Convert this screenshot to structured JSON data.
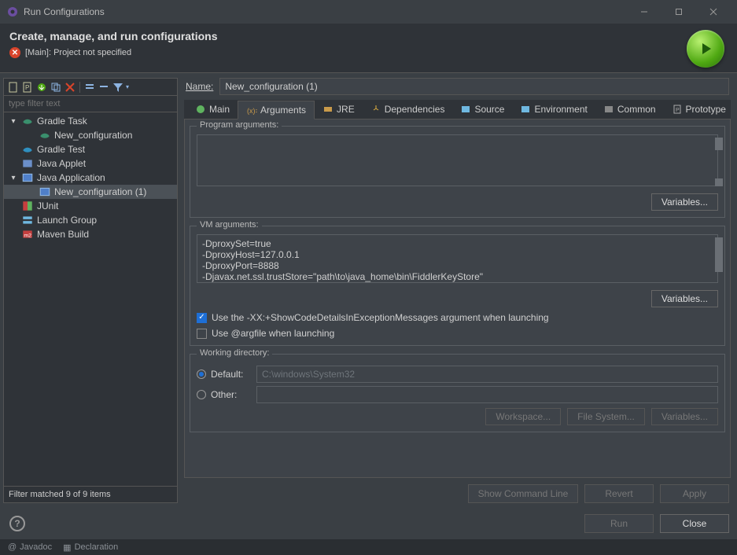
{
  "window": {
    "title": "Run Configurations"
  },
  "header": {
    "title": "Create, manage, and run configurations",
    "error": "[Main]: Project not specified"
  },
  "left": {
    "filter_placeholder": "type filter text",
    "status": "Filter matched 9 of 9 items",
    "tree": [
      {
        "label": "Gradle Task",
        "expand": true,
        "icon": "gradle"
      },
      {
        "label": "New_configuration",
        "indent": 2,
        "icon": "gradle"
      },
      {
        "label": "Gradle Test",
        "icon": "gradle-test",
        "indent": 1
      },
      {
        "label": "Java Applet",
        "icon": "applet",
        "indent": 1
      },
      {
        "label": "Java Application",
        "icon": "java-app",
        "expand": true
      },
      {
        "label": "New_configuration (1)",
        "indent": 2,
        "icon": "java-app",
        "selected": true
      },
      {
        "label": "JUnit",
        "icon": "junit",
        "indent": 1
      },
      {
        "label": "Launch Group",
        "icon": "launch-group",
        "indent": 1
      },
      {
        "label": "Maven Build",
        "icon": "maven",
        "indent": 1
      }
    ]
  },
  "right": {
    "name_label": "Name:",
    "name_value": "New_configuration (1)",
    "tabs": [
      {
        "label": "Main"
      },
      {
        "label": "Arguments",
        "active": true
      },
      {
        "label": "JRE"
      },
      {
        "label": "Dependencies"
      },
      {
        "label": "Source"
      },
      {
        "label": "Environment"
      },
      {
        "label": "Common"
      },
      {
        "label": "Prototype"
      }
    ],
    "program_args": {
      "title": "Program arguments:",
      "value": "",
      "variables_btn": "Variables..."
    },
    "vm_args": {
      "title": "VM arguments:",
      "value": "-DproxySet=true\n-DproxyHost=127.0.0.1\n-DproxyPort=8888\n-Djavax.net.ssl.trustStore=\"path\\to\\java_home\\bin\\FiddlerKeyStore\"",
      "variables_btn": "Variables...",
      "check1": "Use the -XX:+ShowCodeDetailsInExceptionMessages argument when launching",
      "check2": "Use @argfile when launching"
    },
    "working_dir": {
      "title": "Working directory:",
      "default_label": "Default:",
      "default_value": "C:\\windows\\System32",
      "other_label": "Other:",
      "workspace_btn": "Workspace...",
      "filesystem_btn": "File System...",
      "variables_btn": "Variables..."
    },
    "lower": {
      "show_cmd": "Show Command Line",
      "revert": "Revert",
      "apply": "Apply"
    }
  },
  "footer": {
    "run": "Run",
    "close": "Close"
  },
  "bottombar": {
    "item1": "Javadoc",
    "item2": "Declaration"
  }
}
